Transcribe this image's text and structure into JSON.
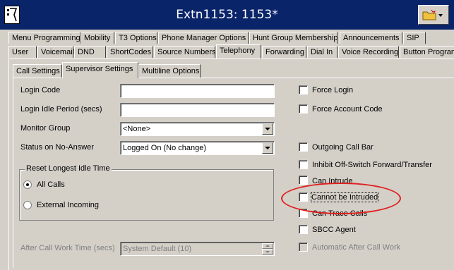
{
  "window": {
    "title": "Extn1153: 1153*"
  },
  "tabs_row1": [
    "Menu Programming",
    "Mobility",
    "T3 Options",
    "Phone Manager Options",
    "Hunt Group Membership",
    "Announcements",
    "SIP"
  ],
  "tabs_row2": [
    "User",
    "Voicemail",
    "DND",
    "ShortCodes",
    "Source Numbers",
    "Telephony",
    "Forwarding",
    "Dial In",
    "Voice Recording",
    "Button Program"
  ],
  "active_tab": "Telephony",
  "subtabs": [
    "Call Settings",
    "Supervisor Settings",
    "Multiline Options"
  ],
  "active_subtab": "Supervisor Settings",
  "form": {
    "login_code": {
      "label": "Login Code",
      "value": ""
    },
    "login_idle": {
      "label": "Login Idle Period (secs)",
      "value": ""
    },
    "monitor_group": {
      "label": "Monitor Group",
      "value": "<None>"
    },
    "status_no_answer": {
      "label": "Status on No-Answer",
      "value": "Logged On (No change)"
    },
    "reset_idle": {
      "title": "Reset Longest Idle Time",
      "options": [
        "All Calls",
        "External Incoming"
      ],
      "selected": "All Calls"
    },
    "after_call_work": {
      "label": "After Call Work Time (secs)",
      "value": "System Default (10)"
    }
  },
  "checkboxes": {
    "force_login": {
      "label": "Force Login",
      "checked": false
    },
    "force_account_code": {
      "label": "Force Account Code",
      "checked": false
    },
    "outgoing_call_bar": {
      "label": "Outgoing Call Bar",
      "checked": false
    },
    "inhibit_off_switch": {
      "label": "Inhibit Off-Switch Forward/Transfer",
      "checked": false
    },
    "can_intrude": {
      "label": "Can Intrude",
      "checked": false
    },
    "cannot_be_intruded": {
      "label": "Cannot be Intruded",
      "checked": false
    },
    "can_trace_calls": {
      "label": "Can Trace Calls",
      "checked": false
    },
    "sbcc_agent": {
      "label": "SBCC Agent",
      "checked": false
    },
    "automatic_after_call_work": {
      "label": "Automatic After Call Work",
      "checked": false,
      "disabled": true
    }
  },
  "colors": {
    "titlebar": "#0a246a",
    "face": "#d4d0c8",
    "annotation": "#e02020"
  }
}
